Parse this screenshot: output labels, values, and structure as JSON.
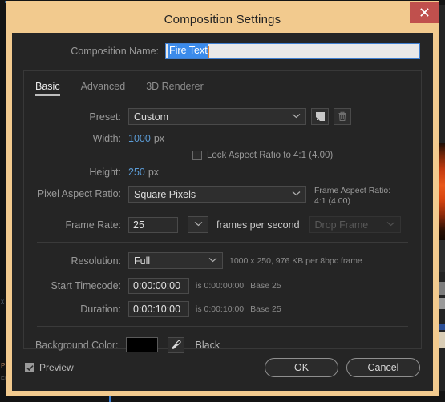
{
  "window": {
    "title": "Composition Settings",
    "close_icon": "close-icon"
  },
  "composition_name": {
    "label": "Composition Name:",
    "value": "Fire Text"
  },
  "tabs": [
    {
      "label": "Basic",
      "active": true
    },
    {
      "label": "Advanced",
      "active": false
    },
    {
      "label": "3D Renderer",
      "active": false
    }
  ],
  "basic": {
    "preset": {
      "label": "Preset:",
      "value": "Custom",
      "save_icon": "save-preset-icon",
      "delete_icon": "trash-icon"
    },
    "width": {
      "label": "Width:",
      "value": "1000",
      "unit": "px"
    },
    "height": {
      "label": "Height:",
      "value": "250",
      "unit": "px"
    },
    "lock_aspect": {
      "label": "Lock Aspect Ratio to 4:1 (4.00)",
      "checked": false
    },
    "pixel_aspect_ratio": {
      "label": "Pixel Aspect Ratio:",
      "value": "Square Pixels"
    },
    "frame_aspect_ratio": {
      "label": "Frame Aspect Ratio:",
      "value": "4:1 (4.00)"
    },
    "frame_rate": {
      "label": "Frame Rate:",
      "value": "25",
      "unit": "frames per second",
      "drop_frame": "Drop Frame"
    },
    "resolution": {
      "label": "Resolution:",
      "value": "Full",
      "info": "1000 x 250, 976 KB per 8bpc frame"
    },
    "start_timecode": {
      "label": "Start Timecode:",
      "value": "0:00:00:00",
      "is_text": "is 0:00:00:00",
      "base_text": "Base 25"
    },
    "duration": {
      "label": "Duration:",
      "value": "0:00:10:00",
      "is_text": "is 0:00:10:00",
      "base_text": "Base 25"
    },
    "background_color": {
      "label": "Background Color:",
      "swatch_hex": "#000000",
      "eyedropper_icon": "eyedropper-icon",
      "name": "Black"
    }
  },
  "footer": {
    "preview": {
      "label": "Preview",
      "checked": true
    },
    "ok_label": "OK",
    "cancel_label": "Cancel"
  },
  "theme": {
    "frame_color": "#f2ca8e",
    "close_color": "#c0504d",
    "panel_bg": "#252525",
    "accent_blue": "#5b9bd5",
    "selection_blue": "#3b8beb"
  }
}
